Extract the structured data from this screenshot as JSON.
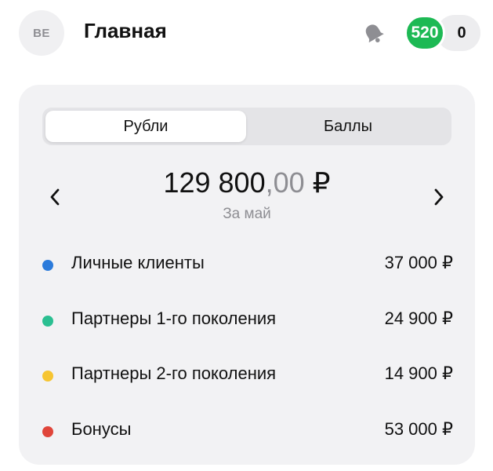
{
  "header": {
    "avatar_initials": "BE",
    "title": "Главная",
    "notifications_icon": "bell-icon",
    "points_badge": "520",
    "count_badge": "0"
  },
  "colors": {
    "badge_green": "#1db954",
    "card_bg": "#f2f2f4",
    "muted_text": "#8e8e93"
  },
  "card": {
    "tabs": [
      {
        "label": "Рубли",
        "active": true
      },
      {
        "label": "Баллы",
        "active": false
      }
    ],
    "prev_icon": "chevron-left-icon",
    "next_icon": "chevron-right-icon",
    "amount_main": "129 800",
    "amount_cents": ",00",
    "currency": " ₽",
    "period": "За май",
    "items": [
      {
        "label": "Личные клиенты",
        "value": "37 000 ₽",
        "color": "#2b7bdb"
      },
      {
        "label": "Партнеры 1-го поколения",
        "value": "24 900 ₽",
        "color": "#2bbf91"
      },
      {
        "label": "Партнеры 2-го поколения",
        "value": "14 900 ₽",
        "color": "#f6c531"
      },
      {
        "label": "Бонусы",
        "value": "53 000 ₽",
        "color": "#e0453a"
      }
    ]
  }
}
